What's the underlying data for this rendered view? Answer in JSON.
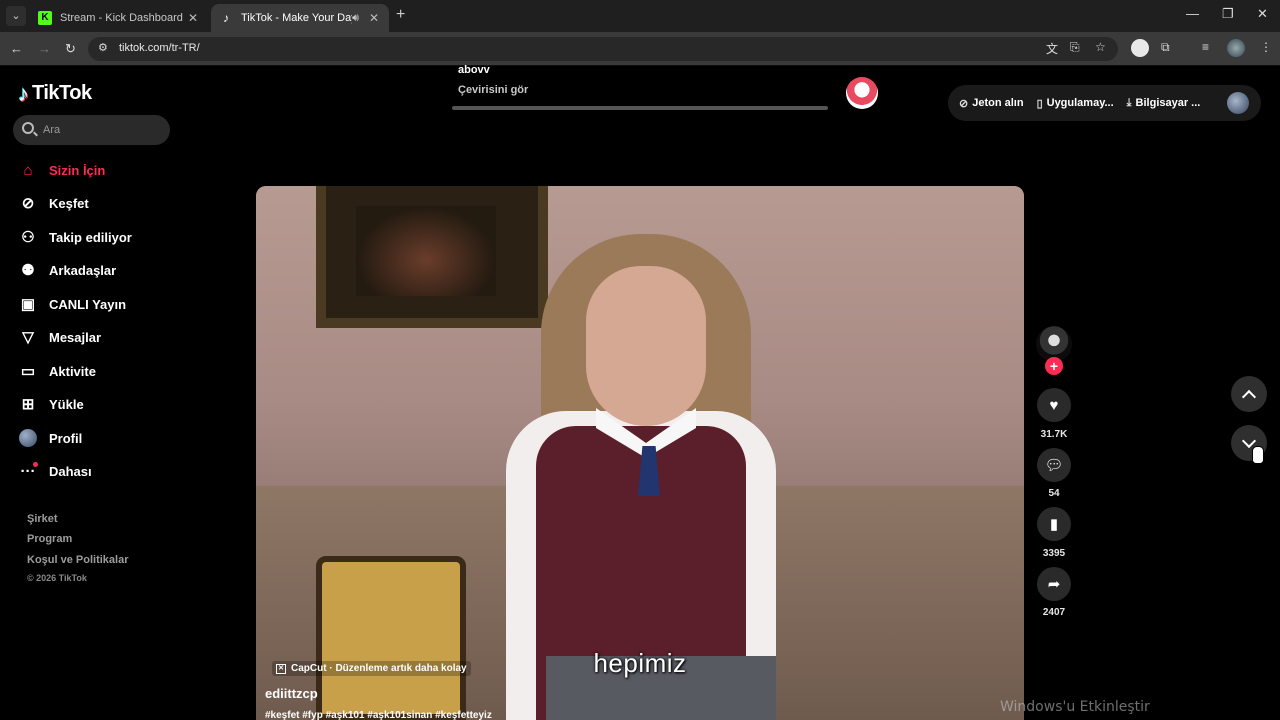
{
  "browser": {
    "tabs": [
      {
        "title": "Stream - Kick Dashboard",
        "favicon": "kick-logo-icon"
      },
      {
        "title": "TikTok - Make Your Day",
        "favicon": "tiktok-logo-icon",
        "active": true
      }
    ],
    "url": "tiktok.com/tr-TR/"
  },
  "tiktok": {
    "logo_text": "TikTok",
    "search_placeholder": "Ara",
    "nav": [
      {
        "label": "Sizin İçin",
        "icon": "home-icon",
        "active": true
      },
      {
        "label": "Keşfet",
        "icon": "compass-icon"
      },
      {
        "label": "Takip ediliyor",
        "icon": "following-icon"
      },
      {
        "label": "Arkadaşlar",
        "icon": "friends-icon"
      },
      {
        "label": "CANLI Yayın",
        "icon": "live-icon"
      },
      {
        "label": "Mesajlar",
        "icon": "messages-icon"
      },
      {
        "label": "Aktivite",
        "icon": "activity-icon"
      },
      {
        "label": "Yükle",
        "icon": "upload-icon"
      },
      {
        "label": "Profil",
        "icon": "avatar"
      },
      {
        "label": "Dahası",
        "icon": "more-icon"
      }
    ],
    "footer": {
      "links": [
        "Şirket",
        "Program",
        "Koşul ve Politikalar"
      ],
      "copyright": "© 2026 TikTok"
    },
    "prev_comment": {
      "user": "abovv",
      "translate": "Çevirisini gör"
    },
    "top_actions": {
      "coins": "Jeton alın",
      "app": "Uygulamay...",
      "desktop": "Bilgisayar ..."
    },
    "video": {
      "subtitle": "hepimiz",
      "capcut_label": "CapCut · Düzenleme artık daha kolay",
      "author": "ediittzcp",
      "hashtags": "#keşfet #fyp #aşk101 #aşk101sinan #keşfetteyiz"
    },
    "actions": {
      "likes": "31.7K",
      "comments": "54",
      "saves": "3395",
      "shares": "2407"
    },
    "accent_color": "#fe2c55"
  },
  "os": {
    "activation_watermark": "Windows'u Etkinleştir"
  }
}
